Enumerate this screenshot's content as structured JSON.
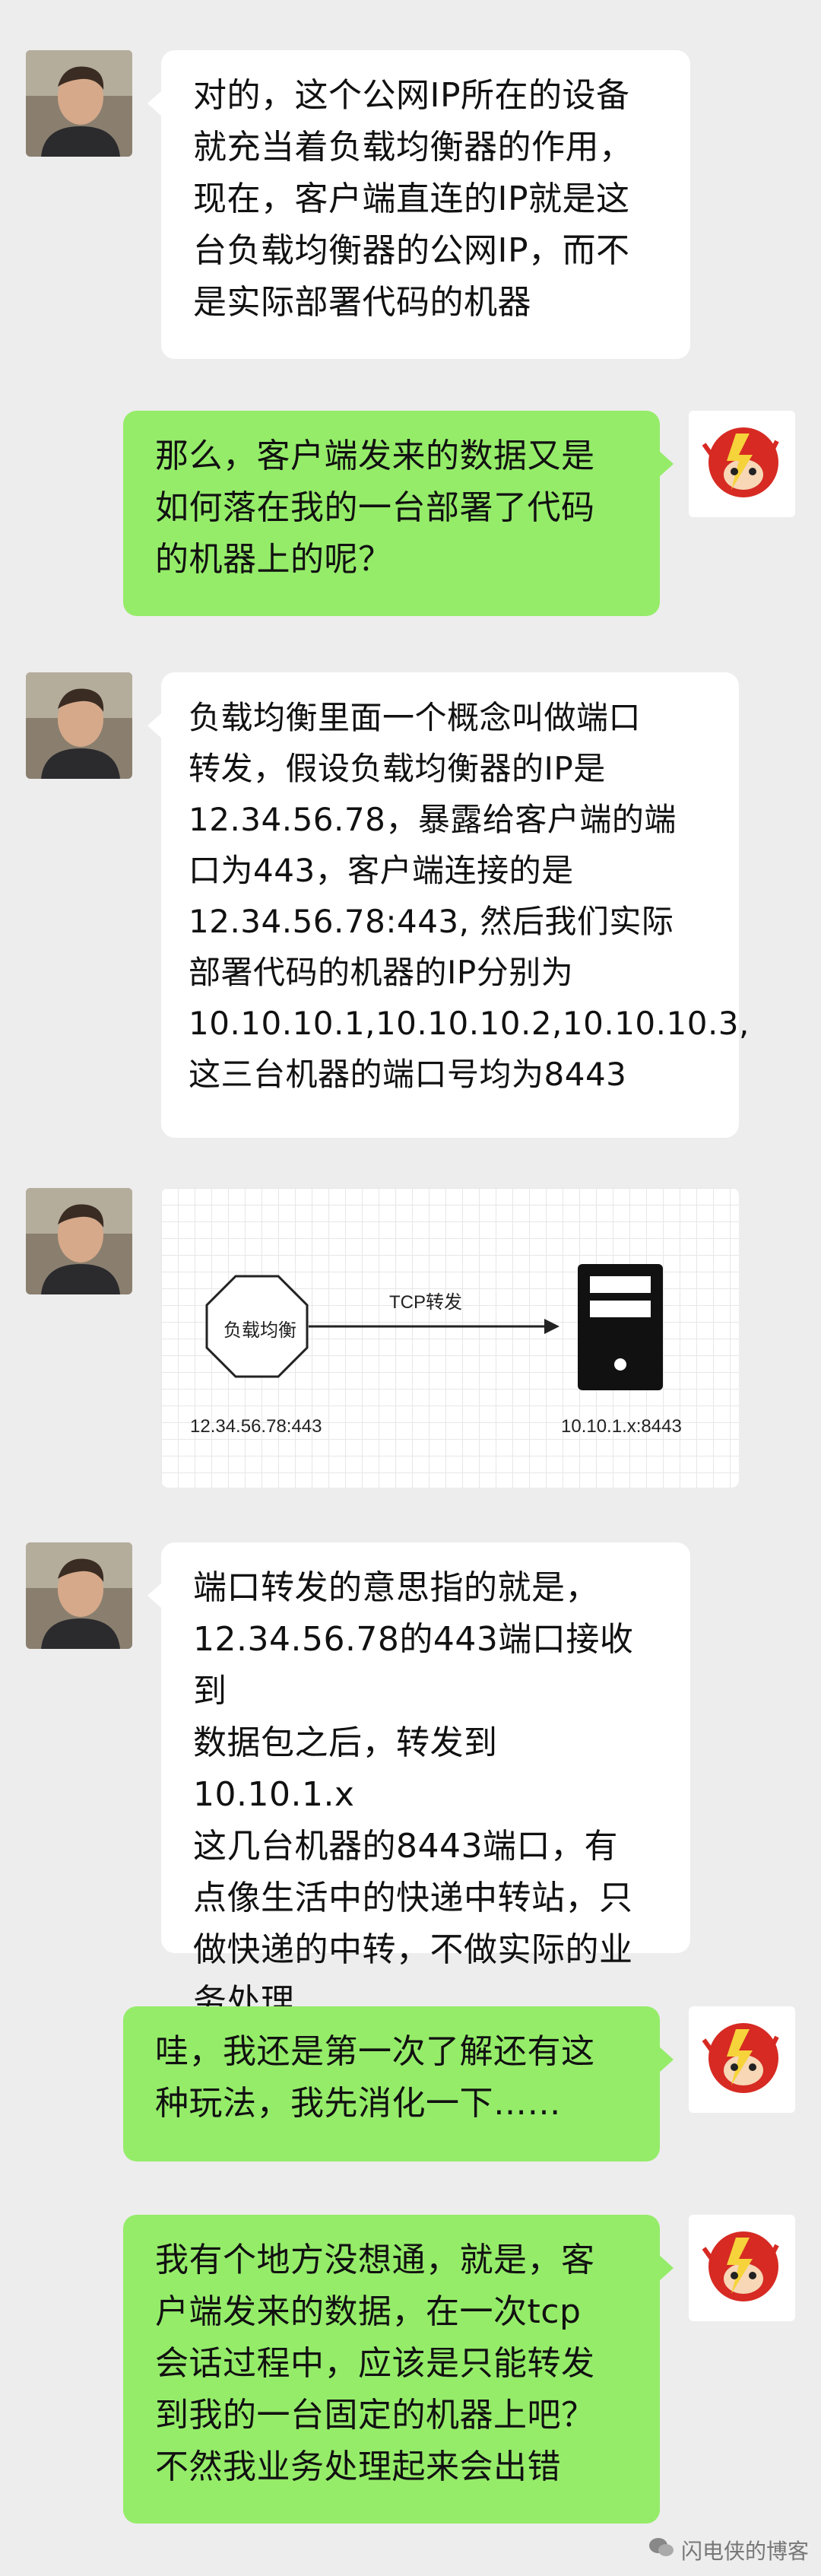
{
  "messages": [
    {
      "side": "left",
      "text": "对的，这个公网IP所在的设备\n就充当着负载均衡器的作用，\n现在，客户端直连的IP就是这\n台负载均衡器的公网IP，而不\n是实际部署代码的机器"
    },
    {
      "side": "right",
      "text": "那么，客户端发来的数据又是\n如何落在我的一台部署了代码\n的机器上的呢？"
    },
    {
      "side": "left",
      "text": "负载均衡里面一个概念叫做端口\n转发，假设负载均衡器的IP是\n12.34.56.78，暴露给客户端的端\n口为443，客户端连接的是\n12.34.56.78:443, 然后我们实际\n部署代码的机器的IP分别为\n10.10.10.1,10.10.10.2,10.10.10.3,\n这三台机器的端口号均为8443"
    },
    {
      "side": "left",
      "type": "diagram"
    },
    {
      "side": "left",
      "text": "端口转发的意思指的就是，\n12.34.56.78的443端口接收到\n数据包之后，转发到10.10.1.x\n这几台机器的8443端口，有\n点像生活中的快递中转站，只\n做快递的中转，不做实际的业\n务处理"
    },
    {
      "side": "right",
      "text": "哇，我还是第一次了解还有这\n种玩法，我先消化一下……"
    },
    {
      "side": "right",
      "text": "我有个地方没想通，就是，客\n户端发来的数据，在一次tcp\n会话过程中，应该是只能转发\n到我的一台固定的机器上吧？\n不然我业务处理起来会出错"
    }
  ],
  "diagram": {
    "node_label": "负载均衡",
    "edge_label": "TCP转发",
    "left_ip": "12.34.56.78:443",
    "right_ip": "10.10.1.x:8443"
  },
  "watermark": {
    "text": "闪电侠的博客",
    "icon": "wechat-icon"
  },
  "colors": {
    "background": "#ededed",
    "bubble_other": "#ffffff",
    "bubble_self": "#95ec69"
  }
}
